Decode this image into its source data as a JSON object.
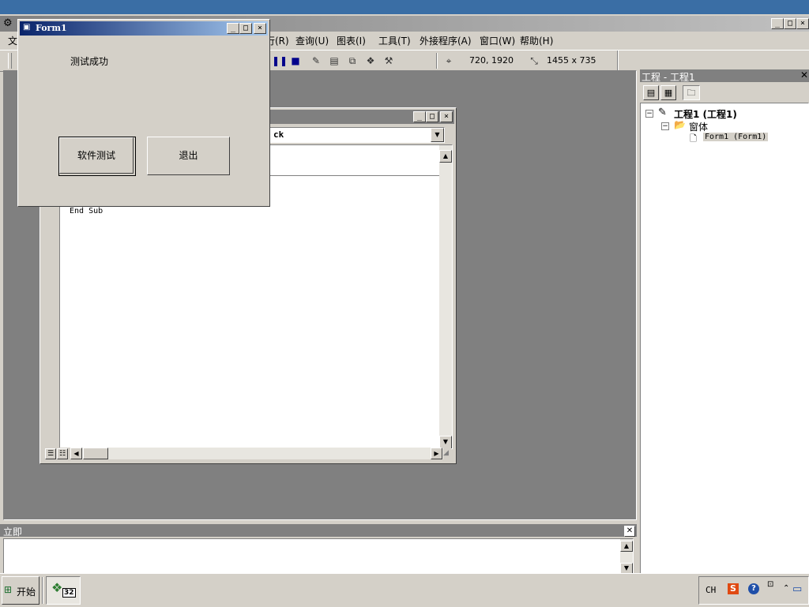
{
  "ide": {
    "menu": [
      "文",
      "行(R)",
      "查询(U)",
      "图表(I)",
      "工具(T)",
      "外接程序(A)",
      "窗口(W)",
      "帮助(H)"
    ],
    "toolbar": {
      "position": "720, 1920",
      "size": "1455 x 735"
    },
    "window_controls": {
      "minimize": "_",
      "restore": "□",
      "close": "×"
    }
  },
  "code_window": {
    "object_combo": "ck",
    "code": "End Sub"
  },
  "form1": {
    "title": "Form1",
    "label": "测试成功",
    "test_button": "软件测试",
    "exit_button": "退出"
  },
  "project_explorer": {
    "title": "工程 - 工程1",
    "root": "工程1 (工程1)",
    "folder": "窗体",
    "form_item": "Form1 (Form1)"
  },
  "immediate": {
    "title": "立即"
  },
  "taskbar": {
    "start": "开始",
    "app_badge": "32",
    "lang": "CH",
    "ime_label": "S",
    "help": "?"
  }
}
